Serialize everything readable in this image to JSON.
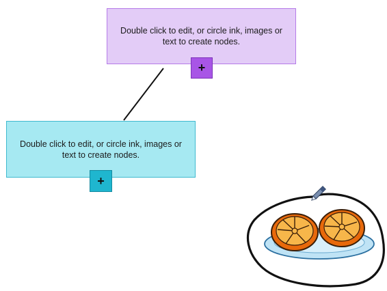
{
  "canvas": {
    "background": "#ffffff"
  },
  "nodes": [
    {
      "text": "Double click to edit, or circle ink, images or text to create nodes.",
      "color": "#e3ccf7",
      "border": "#b57be8",
      "add_button": {
        "label": "+",
        "color": "#a855e6"
      }
    },
    {
      "text": "Double click to edit, or circle ink, images or text to create nodes.",
      "color": "#a6e9f2",
      "border": "#3fb9cf",
      "add_button": {
        "label": "+",
        "color": "#1fb6cf"
      }
    }
  ],
  "connector": {
    "color": "#111111"
  },
  "ink_selection": {
    "stroke_color": "#111111"
  },
  "clipart": {
    "subject": "orange-halves-on-plate"
  },
  "pen_cursor": {
    "icon": "pen-icon"
  }
}
